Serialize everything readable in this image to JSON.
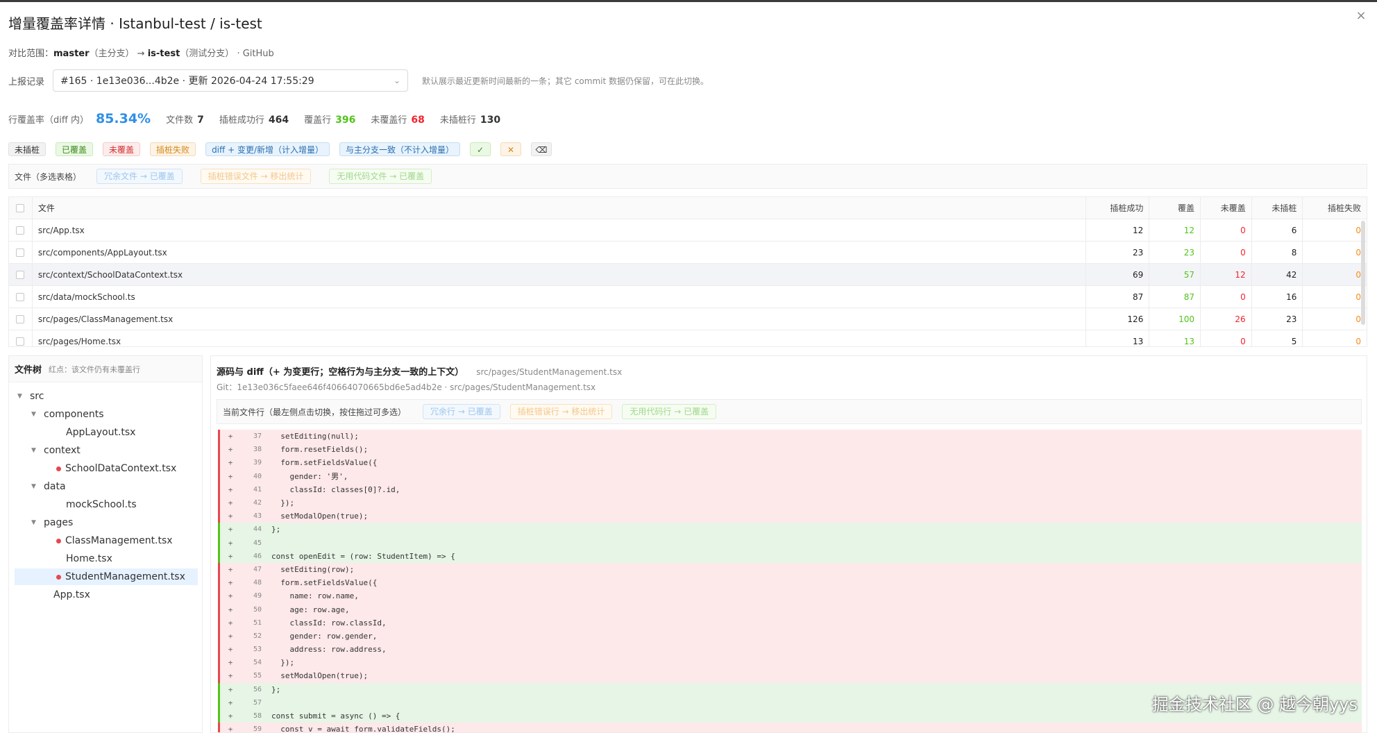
{
  "title": "增量覆盖率详情 · Istanbul-test / is-test",
  "range": {
    "label": "对比范围：",
    "base_branch": "master",
    "base_note": "（主分支）",
    "arrow": "→",
    "target_branch": "is-test",
    "target_note": "（测试分支）",
    "source": "· GitHub"
  },
  "report": {
    "label": "上报记录",
    "selected": "#165 · 1e13e036...4b2e · 更新 2026-04-24 17:55:29",
    "hint": "默认展示最近更新时间最新的一条；其它 commit 数据仍保留，可在此切换。"
  },
  "stats": {
    "coverage_label": "行覆盖率（diff 内）",
    "coverage_value": "85.34%",
    "files_label": "文件数",
    "files_value": "7",
    "instrumented_label": "插桩成功行",
    "instrumented_value": "464",
    "covered_label": "覆盖行",
    "covered_value": "396",
    "uncovered_label": "未覆盖行",
    "uncovered_value": "68",
    "not_instrumented_label": "未插桩行",
    "not_instrumented_value": "130"
  },
  "legend": {
    "not_instrumented": "未插桩",
    "covered": "已覆盖",
    "uncovered": "未覆盖",
    "failed": "插桩失败",
    "diff_changed": "diff + 变更/新增（计入增量）",
    "same_as_main": "与主分支一致（不计入增量）",
    "icon_check": "✓",
    "icon_x": "✕",
    "icon_clear": "⌫"
  },
  "filebar": {
    "label": "文件（多选表格）",
    "btn_redundant": "冗余文件 → 已覆盖",
    "btn_error": "插桩错误文件 → 移出统计",
    "btn_dead": "无用代码文件 → 已覆盖"
  },
  "table": {
    "headers": {
      "file": "文件",
      "instrumented": "插桩成功",
      "covered": "覆盖",
      "uncovered": "未覆盖",
      "not_instrumented": "未插桩",
      "failed": "插桩失败"
    },
    "rows": [
      {
        "file": "src/App.tsx",
        "instrumented": "12",
        "covered": "12",
        "uncovered": "0",
        "not_instrumented": "6",
        "failed": "0"
      },
      {
        "file": "src/components/AppLayout.tsx",
        "instrumented": "23",
        "covered": "23",
        "uncovered": "0",
        "not_instrumented": "8",
        "failed": "0"
      },
      {
        "file": "src/context/SchoolDataContext.tsx",
        "instrumented": "69",
        "covered": "57",
        "uncovered": "12",
        "not_instrumented": "42",
        "failed": "0"
      },
      {
        "file": "src/data/mockSchool.ts",
        "instrumented": "87",
        "covered": "87",
        "uncovered": "0",
        "not_instrumented": "16",
        "failed": "0"
      },
      {
        "file": "src/pages/ClassManagement.tsx",
        "instrumented": "126",
        "covered": "100",
        "uncovered": "26",
        "not_instrumented": "23",
        "failed": "0"
      },
      {
        "file": "src/pages/Home.tsx",
        "instrumented": "13",
        "covered": "13",
        "uncovered": "0",
        "not_instrumented": "5",
        "failed": "0"
      }
    ]
  },
  "tree": {
    "title": "文件树",
    "hint": "红点：该文件仍有未覆盖行",
    "nodes": [
      {
        "label": "src"
      },
      {
        "label": "components"
      },
      {
        "label": "AppLayout.tsx"
      },
      {
        "label": "context"
      },
      {
        "label": "SchoolDataContext.tsx"
      },
      {
        "label": "data"
      },
      {
        "label": "mockSchool.ts"
      },
      {
        "label": "pages"
      },
      {
        "label": "ClassManagement.tsx"
      },
      {
        "label": "Home.tsx"
      },
      {
        "label": "StudentManagement.tsx"
      },
      {
        "label": "App.tsx"
      }
    ]
  },
  "diff": {
    "title": "源码与 diff（+ 为变更行；空格行为与主分支一致的上下文）",
    "path": "src/pages/StudentManagement.tsx",
    "git": "Git：1e13e036c5faee646f40664070665bd6e5ad4b2e · src/pages/StudentManagement.tsx",
    "bar_label": "当前文件行（最左侧点击切换，按住拖过可多选）",
    "btn_redundant": "冗余行 → 已覆盖",
    "btn_error": "插桩错误行 → 移出统计",
    "btn_dead": "无用代码行 → 已覆盖",
    "lines": [
      {
        "mark": "+",
        "num": "37",
        "code": "  setEditing(null);"
      },
      {
        "mark": "+",
        "num": "38",
        "code": "  form.resetFields();"
      },
      {
        "mark": "+",
        "num": "39",
        "code": "  form.setFieldsValue({"
      },
      {
        "mark": "+",
        "num": "40",
        "code": "    gender: '男',"
      },
      {
        "mark": "+",
        "num": "41",
        "code": "    classId: classes[0]?.id,"
      },
      {
        "mark": "+",
        "num": "42",
        "code": "  });"
      },
      {
        "mark": "+",
        "num": "43",
        "code": "  setModalOpen(true);"
      },
      {
        "mark": "+",
        "num": "44",
        "code": "};"
      },
      {
        "mark": "+",
        "num": "45",
        "code": ""
      },
      {
        "mark": "+",
        "num": "46",
        "code": "const openEdit = (row: StudentItem) => {"
      },
      {
        "mark": "+",
        "num": "47",
        "code": "  setEditing(row);"
      },
      {
        "mark": "+",
        "num": "48",
        "code": "  form.setFieldsValue({"
      },
      {
        "mark": "+",
        "num": "49",
        "code": "    name: row.name,"
      },
      {
        "mark": "+",
        "num": "50",
        "code": "    age: row.age,"
      },
      {
        "mark": "+",
        "num": "51",
        "code": "    classId: row.classId,"
      },
      {
        "mark": "+",
        "num": "52",
        "code": "    gender: row.gender,"
      },
      {
        "mark": "+",
        "num": "53",
        "code": "    address: row.address,"
      },
      {
        "mark": "+",
        "num": "54",
        "code": "  });"
      },
      {
        "mark": "+",
        "num": "55",
        "code": "  setModalOpen(true);"
      },
      {
        "mark": "+",
        "num": "56",
        "code": "};"
      },
      {
        "mark": "+",
        "num": "57",
        "code": ""
      },
      {
        "mark": "+",
        "num": "58",
        "code": "const submit = async () => {"
      },
      {
        "mark": "+",
        "num": "59",
        "code": "  const v = await form.validateFields();"
      }
    ]
  },
  "watermark": "掘金技术社区 @ 越今朝yys",
  "colors": {
    "accent": "#2f8fe6",
    "covered": "#52c41a",
    "uncovered": "#f5222d",
    "uncovered_bg": "#fde8ea",
    "covered_bg": "#e6f5e6"
  }
}
